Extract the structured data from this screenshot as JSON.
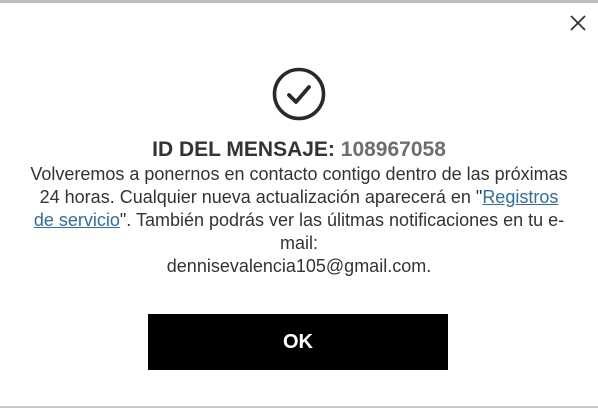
{
  "dialog": {
    "close_icon": "close-icon",
    "success_icon": "check-circle-icon",
    "message_id_label": "ID DEL MENSAJE:",
    "message_id_value": "108967058",
    "body_before_link": "Volveremos a ponernos en contacto contigo dentro de las próximas 24 horas. Cualquier nueva actualización aparecerá en \"",
    "link_text": "Registros de servicio",
    "body_after_link": "\". También podrás ver las úlitmas notificaciones en tu e-mail:",
    "email": "dennisevalencia105@gmail.com.",
    "ok_label": "OK"
  }
}
